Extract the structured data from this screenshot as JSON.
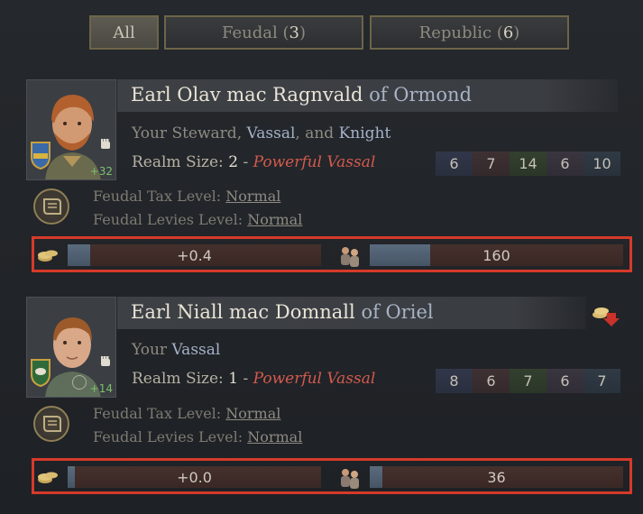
{
  "filters": {
    "all_label": "All",
    "feudal_label": "Feudal",
    "feudal_count": "3",
    "republic_label": "Republic",
    "republic_count": "6"
  },
  "vassals": [
    {
      "title_name": "Earl Olav mac Ragnvald",
      "of_text": "of Ormond",
      "relation_prefix": "Your Steward,",
      "relation_vassal": "Vassal",
      "relation_and": ", and",
      "relation_knight": "Knight",
      "realm_label": "Realm Size:",
      "realm_size": "2",
      "realm_dash": "-",
      "vassal_type": "Powerful Vassal",
      "opinion": "+32",
      "skills": [
        "6",
        "7",
        "14",
        "6",
        "10"
      ],
      "tax_label": "Feudal Tax Level:",
      "tax_value": "Normal",
      "levies_label": "Feudal Levies Level:",
      "levies_value": "Normal",
      "tax_income": "+0.4",
      "tax_fill": 0.09,
      "levies": "160",
      "levies_fill": 0.24
    },
    {
      "title_name": "Earl Niall mac Domnall",
      "of_text": "of Oriel",
      "relation_prefix": "Your",
      "relation_vassal": "Vassal",
      "realm_label": "Realm Size:",
      "realm_size": "1",
      "realm_dash": "-",
      "vassal_type": "Powerful Vassal",
      "opinion": "+14",
      "skills": [
        "8",
        "6",
        "7",
        "6",
        "7"
      ],
      "tax_label": "Feudal Tax Level:",
      "tax_value": "Normal",
      "levies_label": "Feudal Levies Level:",
      "levies_value": "Normal",
      "tax_income": "+0.0",
      "tax_fill": 0.03,
      "levies": "36",
      "levies_fill": 0.05
    }
  ],
  "colors": {
    "accent_border": "#d63a2a",
    "powerful_vassal": "#d35a4e",
    "opinion_positive": "#7cc06a"
  },
  "icons": [
    "coins-icon",
    "levies-icon",
    "law-scroll-icon",
    "coat-of-arms-icon",
    "fist-icon",
    "revoke-title-icon"
  ]
}
